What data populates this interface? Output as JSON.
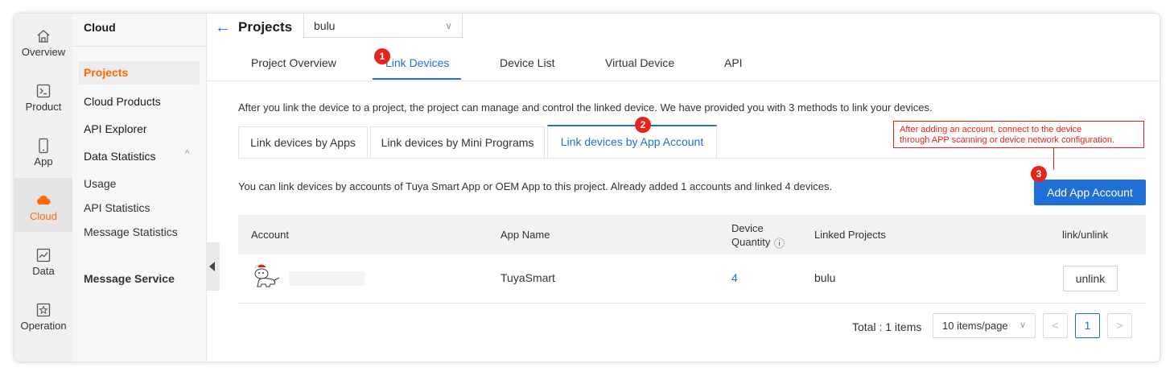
{
  "rail": {
    "items": [
      {
        "label": "Overview",
        "icon": "home-icon"
      },
      {
        "label": "Product",
        "icon": "terminal-icon"
      },
      {
        "label": "App",
        "icon": "mobile-icon"
      },
      {
        "label": "Cloud",
        "icon": "cloud-icon",
        "active": true
      },
      {
        "label": "Data",
        "icon": "chart-icon"
      },
      {
        "label": "Operation",
        "icon": "star-icon"
      }
    ]
  },
  "menu": {
    "title": "Cloud",
    "items": {
      "projects": "Projects",
      "cloud_products": "Cloud Products",
      "api_explorer": "API Explorer",
      "data_statistics": "Data Statistics",
      "usage": "Usage",
      "api_statistics": "API Statistics",
      "message_statistics": "Message Statistics",
      "message_service": "Message Service"
    },
    "expand_glyph": "^"
  },
  "header": {
    "back_glyph": "←",
    "title": "Projects",
    "project_select_value": "bulu",
    "select_chevron": "∨"
  },
  "top_tabs": {
    "overview": "Project Overview",
    "link_devices": "Link Devices",
    "device_list": "Device List",
    "virtual_device": "Virtual Device",
    "api": "API"
  },
  "badges": {
    "b1": "1",
    "b2": "2",
    "b3": "3"
  },
  "intro": "After you link the device to a project, the project can manage and control the linked device. We have provided you with 3 methods to link your devices.",
  "link_tabs": {
    "by_apps": "Link devices by Apps",
    "by_mini": "Link devices by Mini Programs",
    "by_account": "Link devices by App Account"
  },
  "annotation": {
    "line1": "After adding an account, connect to the device",
    "line2": "through APP scanning or device network configuration."
  },
  "info_line": "You can link devices by accounts of Tuya Smart App or OEM App to this project. Already added 1 accounts and linked 4 devices.",
  "add_button": "Add App Account",
  "table": {
    "headers": {
      "account": "Account",
      "app_name": "App Name",
      "device_quantity_1": "Device",
      "device_quantity_2": "Quantity",
      "info_glyph": "ⓘ",
      "linked_projects": "Linked Projects",
      "link_unlink": "link/unlink"
    },
    "rows": [
      {
        "app_name": "TuyaSmart",
        "device_quantity": "4",
        "linked_projects": "bulu",
        "action": "unlink"
      }
    ]
  },
  "pagination": {
    "total": "Total : 1 items",
    "page_size": "10 items/page",
    "chevron": "∨",
    "prev": "<",
    "current": "1",
    "next": ">"
  },
  "colors": {
    "accent": "#1f6fd6",
    "brand": "#ff6a00",
    "annotation": "#e8231a"
  }
}
